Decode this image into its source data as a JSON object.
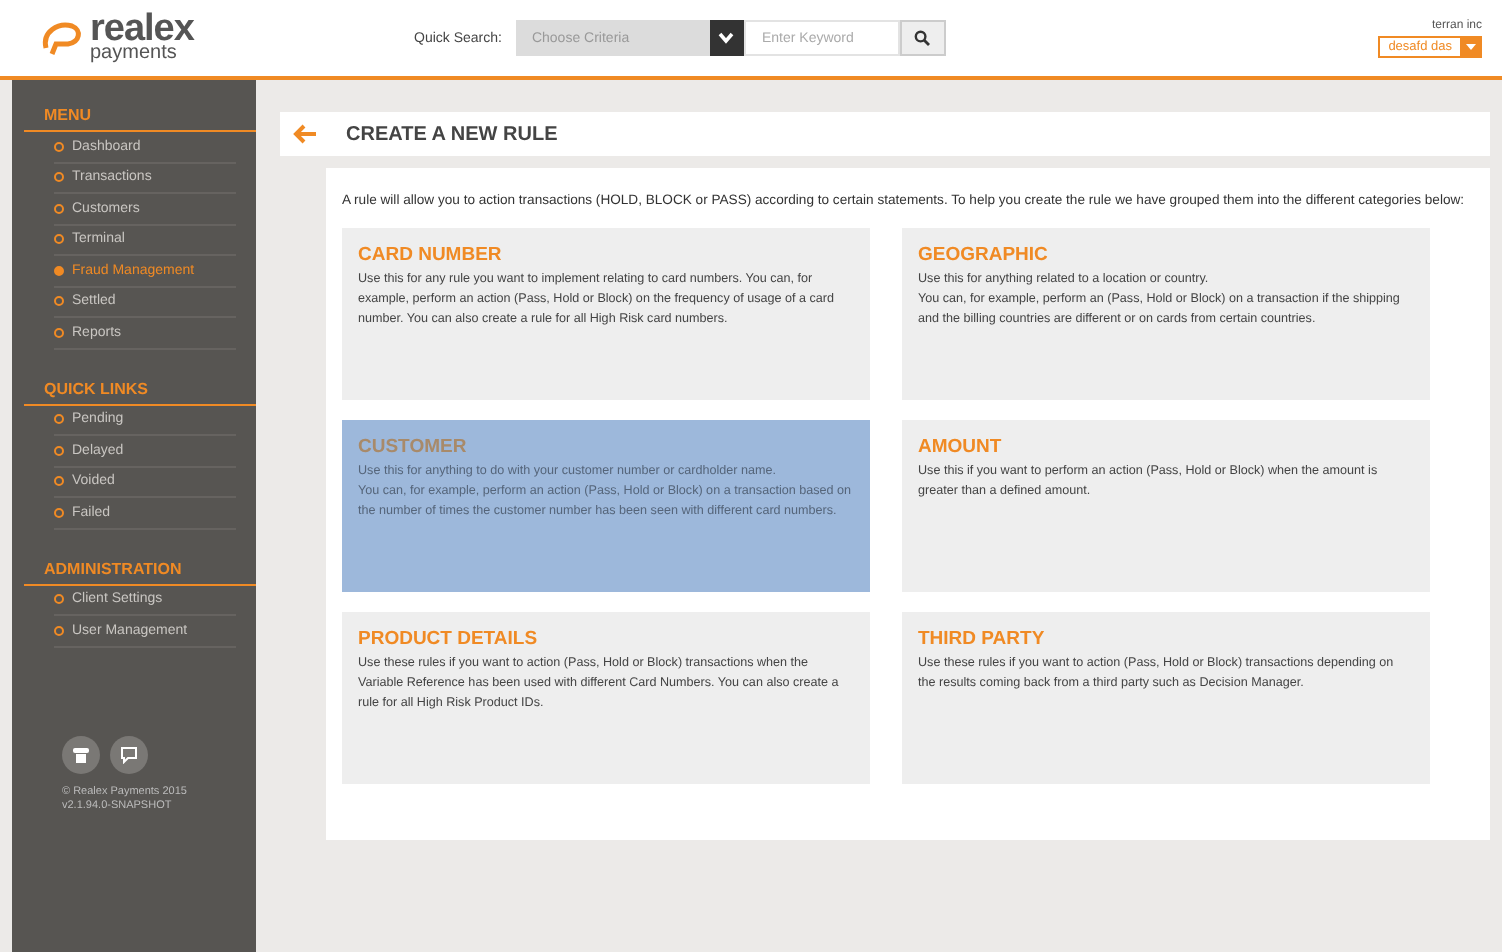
{
  "header": {
    "logo": {
      "word": "realex",
      "sub": "payments"
    },
    "quick_search": {
      "label": "Quick Search:",
      "criteria_placeholder": "Choose Criteria",
      "keyword_placeholder": "Enter Keyword"
    },
    "account": {
      "company": "terran inc",
      "user": "desafd das"
    }
  },
  "sidebar": {
    "sections": [
      {
        "title": "MENU",
        "items": [
          {
            "label": "Dashboard",
            "selected": false
          },
          {
            "label": "Transactions",
            "selected": false
          },
          {
            "label": "Customers",
            "selected": false
          },
          {
            "label": "Terminal",
            "selected": false
          },
          {
            "label": "Fraud Management",
            "selected": true
          },
          {
            "label": "Settled",
            "selected": false
          },
          {
            "label": "Reports",
            "selected": false
          }
        ]
      },
      {
        "title": "QUICK LINKS",
        "items": [
          {
            "label": "Pending",
            "selected": false
          },
          {
            "label": "Delayed",
            "selected": false
          },
          {
            "label": "Voided",
            "selected": false
          },
          {
            "label": "Failed",
            "selected": false
          }
        ]
      },
      {
        "title": "ADMINISTRATION",
        "items": [
          {
            "label": "Client Settings",
            "selected": false
          },
          {
            "label": "User Management",
            "selected": false
          }
        ]
      }
    ],
    "footer": [
      "© Realex Payments 2015",
      "v2.1.94.0-SNAPSHOT"
    ]
  },
  "page": {
    "title": "CREATE A NEW RULE",
    "intro": "A rule will allow you to action transactions (HOLD, BLOCK or PASS) according to certain statements. To help you create the rule we have grouped them into the different categories below:",
    "categories": [
      {
        "title": "CARD NUMBER",
        "selected": false,
        "paragraphs": [
          "Use this for any rule you want to implement relating to card numbers. You can, for example, perform an action (Pass, Hold or Block) on the frequency of usage of a card number. You can also create a rule for all High Risk card numbers."
        ]
      },
      {
        "title": "GEOGRAPHIC",
        "selected": false,
        "paragraphs": [
          "Use this for anything related to a location or country.",
          "You can, for example, perform an (Pass, Hold or Block) on a transaction if the shipping and the billing countries are different or on cards from certain countries."
        ]
      },
      {
        "title": "CUSTOMER",
        "selected": true,
        "paragraphs": [
          "Use this for anything to do with your customer number or cardholder name.",
          "You can, for example, perform an action (Pass, Hold or Block) on a transaction based on the number of times the customer number has been seen with different card numbers."
        ]
      },
      {
        "title": "AMOUNT",
        "selected": false,
        "paragraphs": [
          "Use this if you want to perform an action (Pass, Hold or Block) when the amount is greater than a defined amount."
        ]
      },
      {
        "title": "PRODUCT DETAILS",
        "selected": false,
        "paragraphs": [
          "Use these rules if you want to action (Pass, Hold or Block) transactions when the Variable Reference has been used with different Card Numbers. You can also create a rule for all High Risk Product IDs."
        ]
      },
      {
        "title": "THIRD PARTY",
        "selected": false,
        "paragraphs": [
          "Use these rules if you want to action (Pass, Hold or Block) transactions depending on the results coming back from a third party such as Decision Manager."
        ]
      }
    ]
  }
}
